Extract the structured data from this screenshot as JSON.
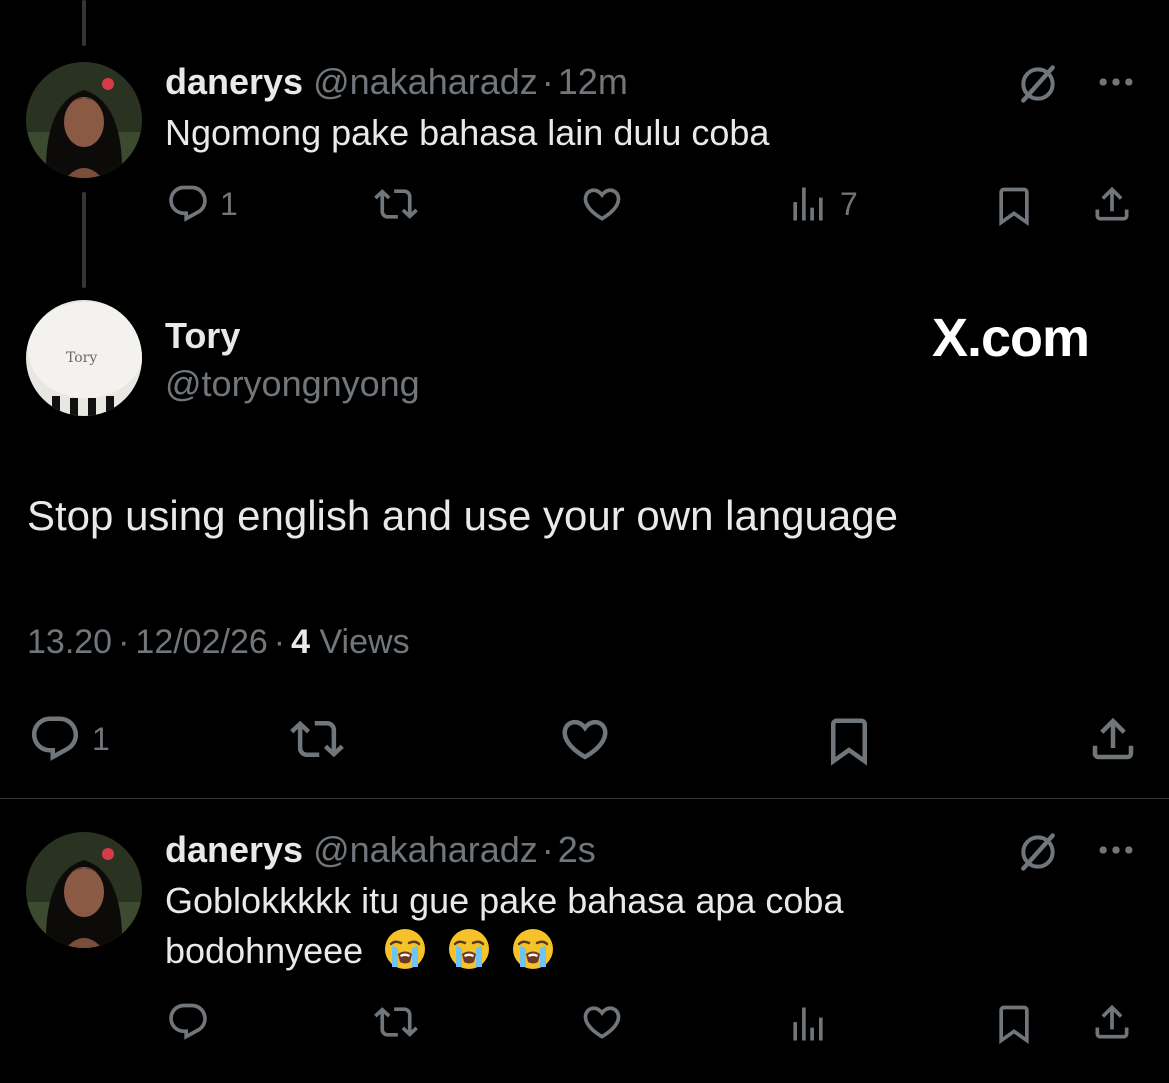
{
  "colors": {
    "background": "#000000",
    "text": "#e7e9ea",
    "muted": "#71767b",
    "divider": "#2f3336"
  },
  "reply1": {
    "name": "danerys",
    "handle": "@nakaharadz",
    "separator": "·",
    "time": "12m",
    "text": "Ngomong pake bahasa lain dulu coba",
    "reply_count": "1",
    "view_count": "7",
    "icons": [
      "grok-icon",
      "more-icon",
      "reply-icon",
      "retweet-icon",
      "like-icon",
      "views-icon",
      "bookmark-icon",
      "share-icon"
    ]
  },
  "main": {
    "name": "Tory",
    "handle": "@toryongnyong",
    "watermark": "X.com",
    "text": "Stop using english and use your own language",
    "time": "13.20",
    "separator": "·",
    "date": "12/02/26",
    "views_count": "4",
    "views_label": "Views",
    "reply_count": "1",
    "avatar_label": "Tory",
    "icons": [
      "reply-icon",
      "retweet-icon",
      "like-icon",
      "bookmark-icon",
      "share-icon"
    ]
  },
  "reply2": {
    "name": "danerys",
    "handle": "@nakaharadz",
    "separator": "·",
    "time": "2s",
    "text_line1": "Goblokkkkk itu gue pake bahasa apa coba",
    "text_line2": "bodohnyeee",
    "emojis": [
      "loudly-crying-face",
      "loudly-crying-face",
      "loudly-crying-face"
    ],
    "icons": [
      "grok-icon",
      "more-icon",
      "reply-icon",
      "retweet-icon",
      "like-icon",
      "views-icon",
      "bookmark-icon",
      "share-icon"
    ]
  }
}
